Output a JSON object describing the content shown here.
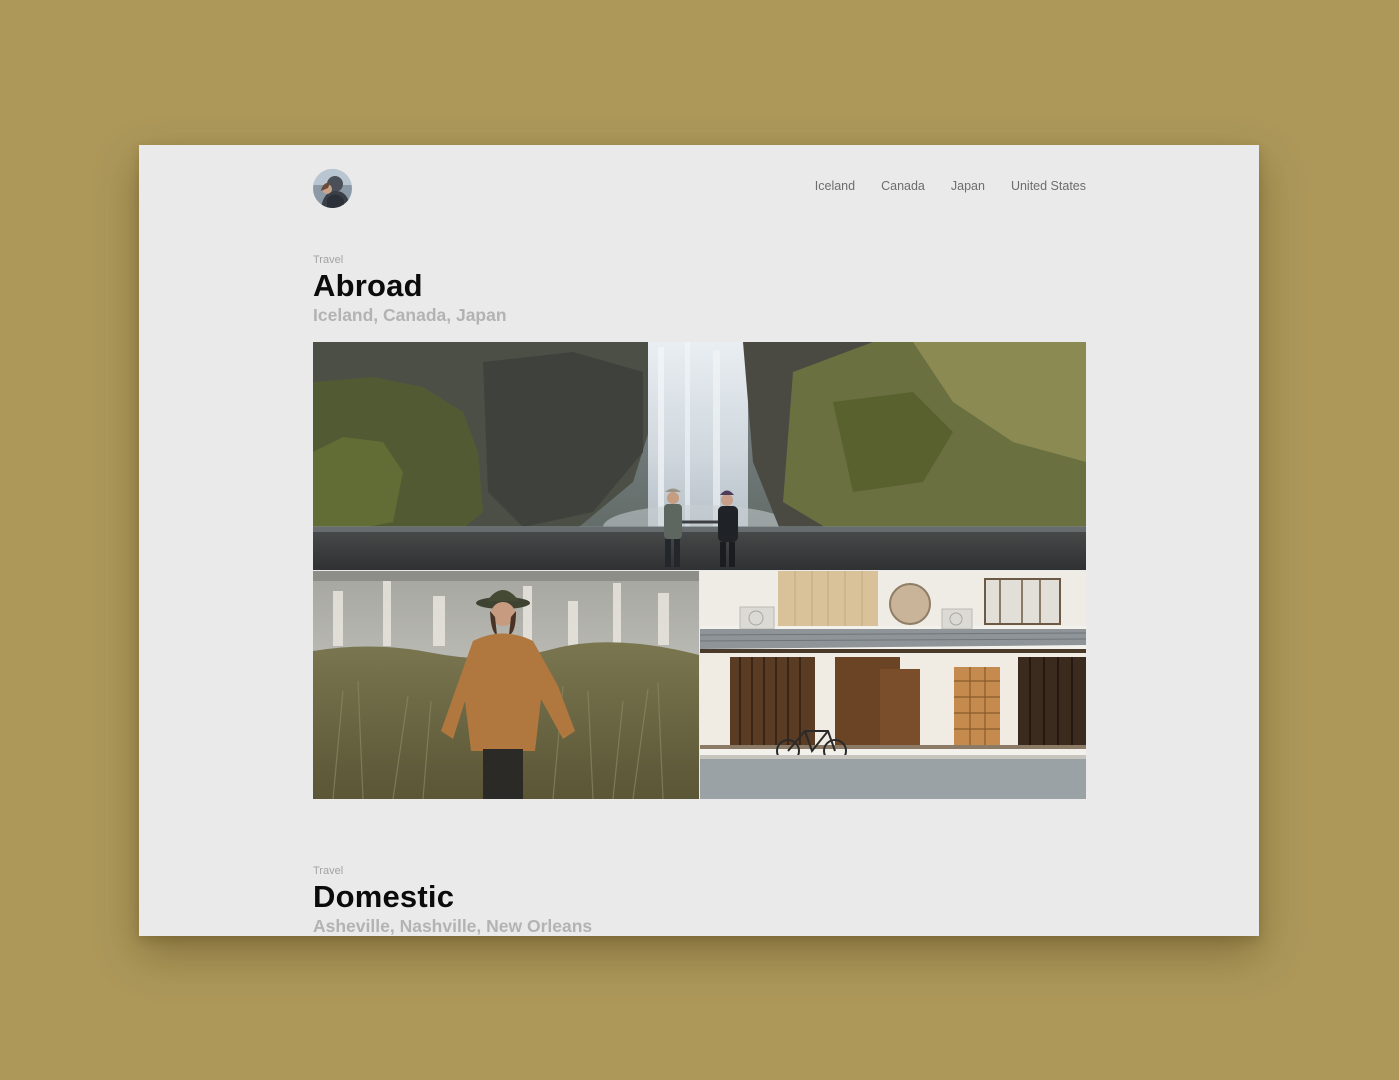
{
  "nav": {
    "avatar_icon": "profile-avatar-icon",
    "items": [
      {
        "label": "Iceland"
      },
      {
        "label": "Canada"
      },
      {
        "label": "Japan"
      },
      {
        "label": "United States"
      }
    ]
  },
  "sections": [
    {
      "kicker": "Travel",
      "title": "Abroad",
      "subtitle": "Iceland, Canada, Japan",
      "photos": [
        {
          "subject": "waterfall-couple-photo"
        },
        {
          "subject": "woman-in-field-photo"
        },
        {
          "subject": "japanese-storefront-photo"
        }
      ]
    },
    {
      "kicker": "Travel",
      "title": "Domestic",
      "subtitle": "Asheville, Nashville, New Orleans"
    }
  ],
  "colors": {
    "page_background": "#ad985a",
    "window_background": "#eaeaea",
    "title": "#0b0b0b",
    "subtitle": "#b3b3b3",
    "nav_text": "#6d6d6d"
  }
}
